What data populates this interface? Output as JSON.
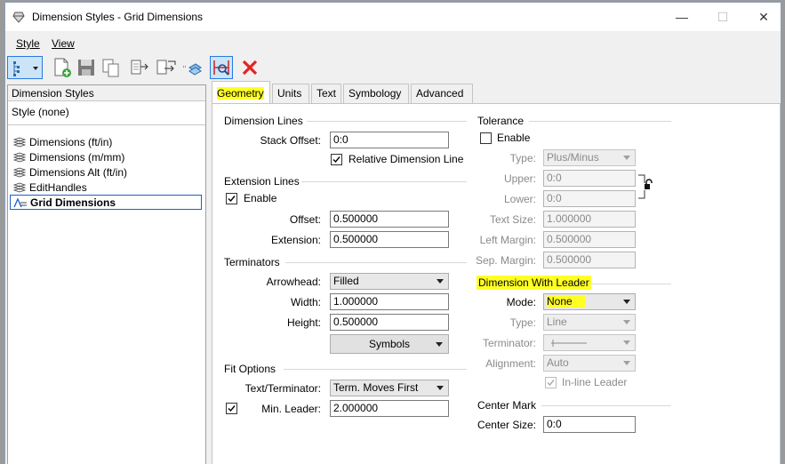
{
  "window": {
    "title": "Dimension Styles -  Grid Dimensions",
    "min_glyph": "—",
    "max_glyph": "☐",
    "close_glyph": "✕"
  },
  "menu": {
    "items": [
      "Style",
      "View"
    ]
  },
  "left_pane": {
    "header": "Dimension Styles",
    "current": "Style (none)",
    "items": [
      "Dimensions (ft/in)",
      "Dimensions (m/mm)",
      "Dimensions Alt (ft/in)",
      "EditHandles",
      "Grid Dimensions"
    ],
    "selected": "Grid Dimensions"
  },
  "tabs": [
    "Geometry",
    "Units",
    "Text",
    "Symbology",
    "Advanced"
  ],
  "active_tab": "Geometry",
  "dimension_lines": {
    "title": "Dimension Lines",
    "stack_offset_label": "Stack Offset:",
    "stack_offset": "0:0",
    "relative_label": "Relative Dimension Line",
    "relative_checked": true
  },
  "extension_lines": {
    "title": "Extension Lines",
    "enable_label": "Enable",
    "enable_checked": true,
    "offset_label": "Offset:",
    "offset": "0.500000",
    "extension_label": "Extension:",
    "extension": "0.500000"
  },
  "terminators": {
    "title": "Terminators",
    "arrowhead_label": "Arrowhead:",
    "arrowhead": "Filled",
    "width_label": "Width:",
    "width": "1.000000",
    "height_label": "Height:",
    "height": "0.500000",
    "symbols_label": "Symbols"
  },
  "fit_options": {
    "title": "Fit Options",
    "text_terminator_label": "Text/Terminator:",
    "text_terminator": "Term. Moves First",
    "min_leader_label": "Min. Leader:",
    "min_leader": "2.000000",
    "min_leader_checked": true
  },
  "tolerance": {
    "title": "Tolerance",
    "enable_label": "Enable",
    "enable_checked": false,
    "type_label": "Type:",
    "type": "Plus/Minus",
    "upper_label": "Upper:",
    "upper": "0:0",
    "lower_label": "Lower:",
    "lower": "0:0",
    "text_size_label": "Text Size:",
    "text_size": "1.000000",
    "left_margin_label": "Left Margin:",
    "left_margin": "0.500000",
    "sep_margin_label": "Sep. Margin:",
    "sep_margin": "0.500000"
  },
  "dimension_with_leader": {
    "title": "Dimension With Leader",
    "mode_label": "Mode:",
    "mode": "None",
    "type_label": "Type:",
    "type": "Line",
    "terminator_label": "Terminator:",
    "terminator": "",
    "alignment_label": "Alignment:",
    "alignment": "Auto",
    "inline_label": "In-line Leader",
    "inline_checked": true
  },
  "center_mark": {
    "title": "Center Mark",
    "center_size_label": "Center Size:",
    "center_size": "0:0"
  },
  "colors": {
    "highlight": "#ffff26",
    "selection_border": "#1e5ec8",
    "delete_red": "#e52222"
  },
  "icons": [
    "app-icon",
    "tree-view-icon",
    "new-style-icon",
    "save-icon",
    "copy-icon",
    "compare-icon",
    "export-icon",
    "import-icon",
    "match-icon",
    "delete-icon",
    "dimension-style-icon",
    "grid-dimension-icon",
    "lock-icon"
  ]
}
